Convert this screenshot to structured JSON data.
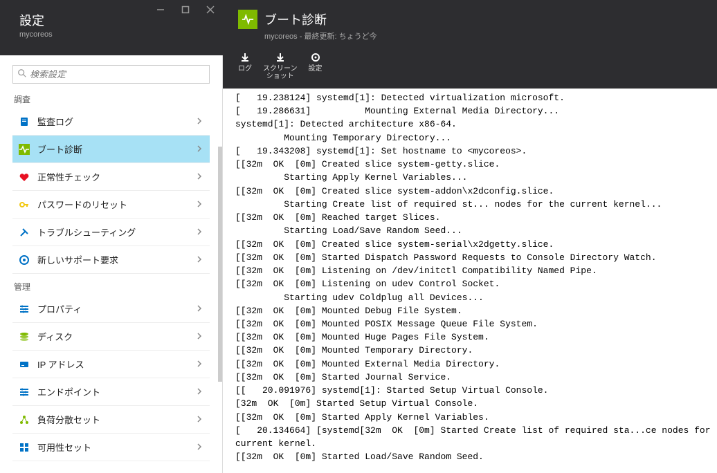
{
  "left": {
    "title": "設定",
    "subtitle": "mycoreos",
    "search_placeholder": "検索設定",
    "groups": [
      {
        "label": "調査",
        "items": [
          {
            "id": "audit-log",
            "label": "監査ログ",
            "icon_color": "#0072c6",
            "icon": "doc"
          },
          {
            "id": "boot-diag",
            "label": "ブート診断",
            "icon_color": "#7fba00",
            "icon": "pulse",
            "selected": true
          },
          {
            "id": "health",
            "label": "正常性チェック",
            "icon_color": "#e81123",
            "icon": "heart"
          },
          {
            "id": "pw-reset",
            "label": "パスワードのリセット",
            "icon_color": "#f2c811",
            "icon": "key"
          },
          {
            "id": "troubleshoot",
            "label": "トラブルシューティング",
            "icon_color": "#0072c6",
            "icon": "tools"
          },
          {
            "id": "support",
            "label": "新しいサポート要求",
            "icon_color": "#0072c6",
            "icon": "support"
          }
        ]
      },
      {
        "label": "管理",
        "items": [
          {
            "id": "properties",
            "label": "プロパティ",
            "icon_color": "#0072c6",
            "icon": "sliders"
          },
          {
            "id": "disks",
            "label": "ディスク",
            "icon_color": "#7fba00",
            "icon": "disks"
          },
          {
            "id": "ip",
            "label": "IP アドレス",
            "icon_color": "#0072c6",
            "icon": "card"
          },
          {
            "id": "endpoints",
            "label": "エンドポイント",
            "icon_color": "#0072c6",
            "icon": "sliders"
          },
          {
            "id": "lb-set",
            "label": "負荷分散セット",
            "icon_color": "#7fba00",
            "icon": "lb"
          },
          {
            "id": "avail-set",
            "label": "可用性セット",
            "icon_color": "#0072c6",
            "icon": "grid"
          }
        ]
      }
    ]
  },
  "right": {
    "title": "ブート診断",
    "subtitle": "mycoreos - 最終更新: ちょうど今",
    "toolbar": [
      {
        "id": "log",
        "label": "ログ",
        "icon": "download"
      },
      {
        "id": "screenshot",
        "label": "スクリーン\nショット",
        "icon": "download"
      },
      {
        "id": "settings",
        "label": "設定",
        "icon": "gear"
      }
    ],
    "log_lines": [
      "[   19.238124] systemd[1]: Detected virtualization microsoft.",
      "[   19.286631]          Mounting External Media Directory...",
      "systemd[1]: Detected architecture x86-64.",
      "         Mounting Temporary Directory...",
      "[   19.343208] systemd[1]: Set hostname to <mycoreos>.",
      "[[32m  OK  [0m] Created slice system-getty.slice.",
      "         Starting Apply Kernel Variables...",
      "[[32m  OK  [0m] Created slice system-addon\\x2dconfig.slice.",
      "         Starting Create list of required st... nodes for the current kernel...",
      "[[32m  OK  [0m] Reached target Slices.",
      "         Starting Load/Save Random Seed...",
      "[[32m  OK  [0m] Created slice system-serial\\x2dgetty.slice.",
      "[[32m  OK  [0m] Started Dispatch Password Requests to Console Directory Watch.",
      "[[32m  OK  [0m] Listening on /dev/initctl Compatibility Named Pipe.",
      "[[32m  OK  [0m] Listening on udev Control Socket.",
      "         Starting udev Coldplug all Devices...",
      "[[32m  OK  [0m] Mounted Debug File System.",
      "[[32m  OK  [0m] Mounted POSIX Message Queue File System.",
      "[[32m  OK  [0m] Mounted Huge Pages File System.",
      "[[32m  OK  [0m] Mounted Temporary Directory.",
      "[[32m  OK  [0m] Mounted External Media Directory.",
      "[[32m  OK  [0m] Started Journal Service.",
      "[[   20.091976] systemd[1]: Started Setup Virtual Console.",
      "[32m  OK  [0m] Started Setup Virtual Console.",
      "[[32m  OK  [0m] Started Apply Kernel Variables.",
      "[   20.134664] [systemd[32m  OK  [0m] Started Create list of required sta...ce nodes for",
      "current kernel.",
      "[[32m  OK  [0m] Started Load/Save Random Seed."
    ]
  }
}
